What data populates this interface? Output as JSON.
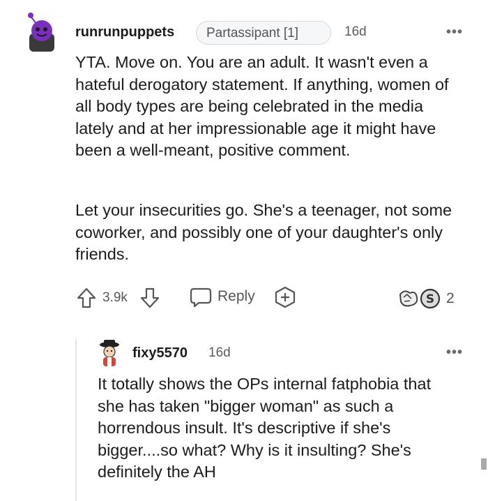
{
  "top_comment": {
    "author": "runrunpuppets",
    "flair": "Partassipant [1]",
    "time": "16d",
    "more": "•••",
    "paragraphs": [
      "YTA. Move on. You are an adult. It wasn't even a hateful derogatory statement. If anything, women of all body types are being celebrated in the media lately and at her impressionable age it might have been a well-meant, positive comment.",
      "Let your insecurities go. She's a teenager, not some coworker, and possibly one of your daughter's only friends."
    ],
    "vote_count": "3.9k",
    "reply_label": "Reply",
    "award_count": "2"
  },
  "reply_comment": {
    "author": "fixy5570",
    "time": "16d",
    "more": "•••",
    "paragraphs": [
      "It totally shows the OPs internal fatphobia that she has taken \"bigger woman\" as such a horrendous insult. It's descriptive if she's bigger....so what? Why is it insulting? She's definitely the AH"
    ]
  },
  "icons": {
    "upvote": "upvote-arrow-icon",
    "downvote": "downvote-arrow-icon",
    "reply": "speech-bubble-icon",
    "award": "add-award-icon",
    "awards": "award-badges-icon",
    "more": "more-options-icon"
  },
  "colors": {
    "text": "#1c1c1c",
    "meta": "#5c5c5c",
    "avatar_purple": "#7b2fbe"
  }
}
